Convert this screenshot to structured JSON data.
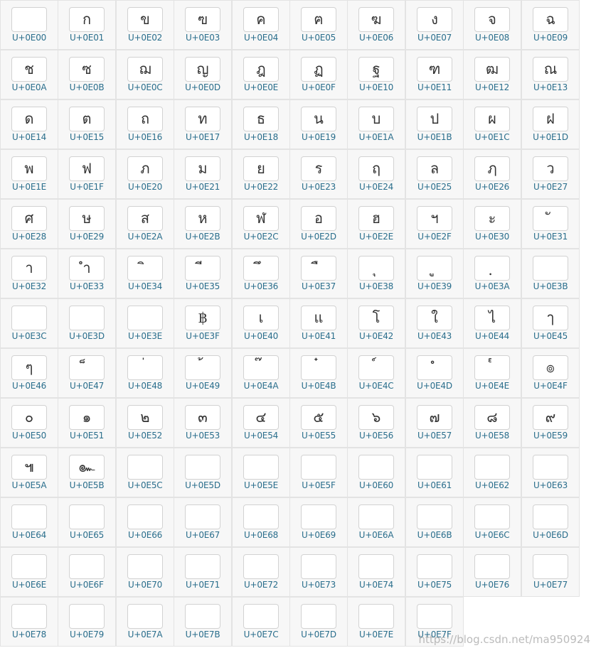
{
  "cells": [
    {
      "glyph": "",
      "code": "U+0E00"
    },
    {
      "glyph": "ก",
      "code": "U+0E01"
    },
    {
      "glyph": "ข",
      "code": "U+0E02"
    },
    {
      "glyph": "ฃ",
      "code": "U+0E03"
    },
    {
      "glyph": "ค",
      "code": "U+0E04"
    },
    {
      "glyph": "ฅ",
      "code": "U+0E05"
    },
    {
      "glyph": "ฆ",
      "code": "U+0E06"
    },
    {
      "glyph": "ง",
      "code": "U+0E07"
    },
    {
      "glyph": "จ",
      "code": "U+0E08"
    },
    {
      "glyph": "ฉ",
      "code": "U+0E09"
    },
    {
      "glyph": "ช",
      "code": "U+0E0A"
    },
    {
      "glyph": "ซ",
      "code": "U+0E0B"
    },
    {
      "glyph": "ฌ",
      "code": "U+0E0C"
    },
    {
      "glyph": "ญ",
      "code": "U+0E0D"
    },
    {
      "glyph": "ฎ",
      "code": "U+0E0E"
    },
    {
      "glyph": "ฏ",
      "code": "U+0E0F"
    },
    {
      "glyph": "ฐ",
      "code": "U+0E10"
    },
    {
      "glyph": "ฑ",
      "code": "U+0E11"
    },
    {
      "glyph": "ฒ",
      "code": "U+0E12"
    },
    {
      "glyph": "ณ",
      "code": "U+0E13"
    },
    {
      "glyph": "ด",
      "code": "U+0E14"
    },
    {
      "glyph": "ต",
      "code": "U+0E15"
    },
    {
      "glyph": "ถ",
      "code": "U+0E16"
    },
    {
      "glyph": "ท",
      "code": "U+0E17"
    },
    {
      "glyph": "ธ",
      "code": "U+0E18"
    },
    {
      "glyph": "น",
      "code": "U+0E19"
    },
    {
      "glyph": "บ",
      "code": "U+0E1A"
    },
    {
      "glyph": "ป",
      "code": "U+0E1B"
    },
    {
      "glyph": "ผ",
      "code": "U+0E1C"
    },
    {
      "glyph": "ฝ",
      "code": "U+0E1D"
    },
    {
      "glyph": "พ",
      "code": "U+0E1E"
    },
    {
      "glyph": "ฟ",
      "code": "U+0E1F"
    },
    {
      "glyph": "ภ",
      "code": "U+0E20"
    },
    {
      "glyph": "ม",
      "code": "U+0E21"
    },
    {
      "glyph": "ย",
      "code": "U+0E22"
    },
    {
      "glyph": "ร",
      "code": "U+0E23"
    },
    {
      "glyph": "ฤ",
      "code": "U+0E24"
    },
    {
      "glyph": "ล",
      "code": "U+0E25"
    },
    {
      "glyph": "ฦ",
      "code": "U+0E26"
    },
    {
      "glyph": "ว",
      "code": "U+0E27"
    },
    {
      "glyph": "ศ",
      "code": "U+0E28"
    },
    {
      "glyph": "ษ",
      "code": "U+0E29"
    },
    {
      "glyph": "ส",
      "code": "U+0E2A"
    },
    {
      "glyph": "ห",
      "code": "U+0E2B"
    },
    {
      "glyph": "ฬ",
      "code": "U+0E2C"
    },
    {
      "glyph": "อ",
      "code": "U+0E2D"
    },
    {
      "glyph": "ฮ",
      "code": "U+0E2E"
    },
    {
      "glyph": "ฯ",
      "code": "U+0E2F"
    },
    {
      "glyph": "ะ",
      "code": "U+0E30"
    },
    {
      "glyph": "ั",
      "code": "U+0E31"
    },
    {
      "glyph": "า",
      "code": "U+0E32"
    },
    {
      "glyph": "ำ",
      "code": "U+0E33"
    },
    {
      "glyph": "ิ",
      "code": "U+0E34"
    },
    {
      "glyph": "ี",
      "code": "U+0E35"
    },
    {
      "glyph": "ึ",
      "code": "U+0E36"
    },
    {
      "glyph": "ื",
      "code": "U+0E37"
    },
    {
      "glyph": "ุ",
      "code": "U+0E38"
    },
    {
      "glyph": "ู",
      "code": "U+0E39"
    },
    {
      "glyph": "ฺ",
      "code": "U+0E3A"
    },
    {
      "glyph": "",
      "code": "U+0E3B"
    },
    {
      "glyph": "",
      "code": "U+0E3C"
    },
    {
      "glyph": "",
      "code": "U+0E3D"
    },
    {
      "glyph": "",
      "code": "U+0E3E"
    },
    {
      "glyph": "฿",
      "code": "U+0E3F"
    },
    {
      "glyph": "เ",
      "code": "U+0E40"
    },
    {
      "glyph": "แ",
      "code": "U+0E41"
    },
    {
      "glyph": "โ",
      "code": "U+0E42"
    },
    {
      "glyph": "ใ",
      "code": "U+0E43"
    },
    {
      "glyph": "ไ",
      "code": "U+0E44"
    },
    {
      "glyph": "ๅ",
      "code": "U+0E45"
    },
    {
      "glyph": "ๆ",
      "code": "U+0E46"
    },
    {
      "glyph": "็",
      "code": "U+0E47"
    },
    {
      "glyph": "่",
      "code": "U+0E48"
    },
    {
      "glyph": "้",
      "code": "U+0E49"
    },
    {
      "glyph": "๊",
      "code": "U+0E4A"
    },
    {
      "glyph": "๋",
      "code": "U+0E4B"
    },
    {
      "glyph": "์",
      "code": "U+0E4C"
    },
    {
      "glyph": "ํ",
      "code": "U+0E4D"
    },
    {
      "glyph": "๎",
      "code": "U+0E4E"
    },
    {
      "glyph": "๏",
      "code": "U+0E4F"
    },
    {
      "glyph": "๐",
      "code": "U+0E50"
    },
    {
      "glyph": "๑",
      "code": "U+0E51"
    },
    {
      "glyph": "๒",
      "code": "U+0E52"
    },
    {
      "glyph": "๓",
      "code": "U+0E53"
    },
    {
      "glyph": "๔",
      "code": "U+0E54"
    },
    {
      "glyph": "๕",
      "code": "U+0E55"
    },
    {
      "glyph": "๖",
      "code": "U+0E56"
    },
    {
      "glyph": "๗",
      "code": "U+0E57"
    },
    {
      "glyph": "๘",
      "code": "U+0E58"
    },
    {
      "glyph": "๙",
      "code": "U+0E59"
    },
    {
      "glyph": "๚",
      "code": "U+0E5A"
    },
    {
      "glyph": "๛",
      "code": "U+0E5B"
    },
    {
      "glyph": "",
      "code": "U+0E5C"
    },
    {
      "glyph": "",
      "code": "U+0E5D"
    },
    {
      "glyph": "",
      "code": "U+0E5E"
    },
    {
      "glyph": "",
      "code": "U+0E5F"
    },
    {
      "glyph": "",
      "code": "U+0E60"
    },
    {
      "glyph": "",
      "code": "U+0E61"
    },
    {
      "glyph": "",
      "code": "U+0E62"
    },
    {
      "glyph": "",
      "code": "U+0E63"
    },
    {
      "glyph": "",
      "code": "U+0E64"
    },
    {
      "glyph": "",
      "code": "U+0E65"
    },
    {
      "glyph": "",
      "code": "U+0E66"
    },
    {
      "glyph": "",
      "code": "U+0E67"
    },
    {
      "glyph": "",
      "code": "U+0E68"
    },
    {
      "glyph": "",
      "code": "U+0E69"
    },
    {
      "glyph": "",
      "code": "U+0E6A"
    },
    {
      "glyph": "",
      "code": "U+0E6B"
    },
    {
      "glyph": "",
      "code": "U+0E6C"
    },
    {
      "glyph": "",
      "code": "U+0E6D"
    },
    {
      "glyph": "",
      "code": "U+0E6E"
    },
    {
      "glyph": "",
      "code": "U+0E6F"
    },
    {
      "glyph": "",
      "code": "U+0E70"
    },
    {
      "glyph": "",
      "code": "U+0E71"
    },
    {
      "glyph": "",
      "code": "U+0E72"
    },
    {
      "glyph": "",
      "code": "U+0E73"
    },
    {
      "glyph": "",
      "code": "U+0E74"
    },
    {
      "glyph": "",
      "code": "U+0E75"
    },
    {
      "glyph": "",
      "code": "U+0E76"
    },
    {
      "glyph": "",
      "code": "U+0E77"
    },
    {
      "glyph": "",
      "code": "U+0E78"
    },
    {
      "glyph": "",
      "code": "U+0E79"
    },
    {
      "glyph": "",
      "code": "U+0E7A"
    },
    {
      "glyph": "",
      "code": "U+0E7B"
    },
    {
      "glyph": "",
      "code": "U+0E7C"
    },
    {
      "glyph": "",
      "code": "U+0E7D"
    },
    {
      "glyph": "",
      "code": "U+0E7E"
    },
    {
      "glyph": "",
      "code": "U+0E7F"
    }
  ],
  "watermark": "https://blog.csdn.net/ma950924",
  "colors": {
    "code_text": "#2a6e8c",
    "cell_bg": "#f7f7f7",
    "cell_border": "#e3e3e3",
    "glyph_box_border": "#d2d2d2"
  }
}
